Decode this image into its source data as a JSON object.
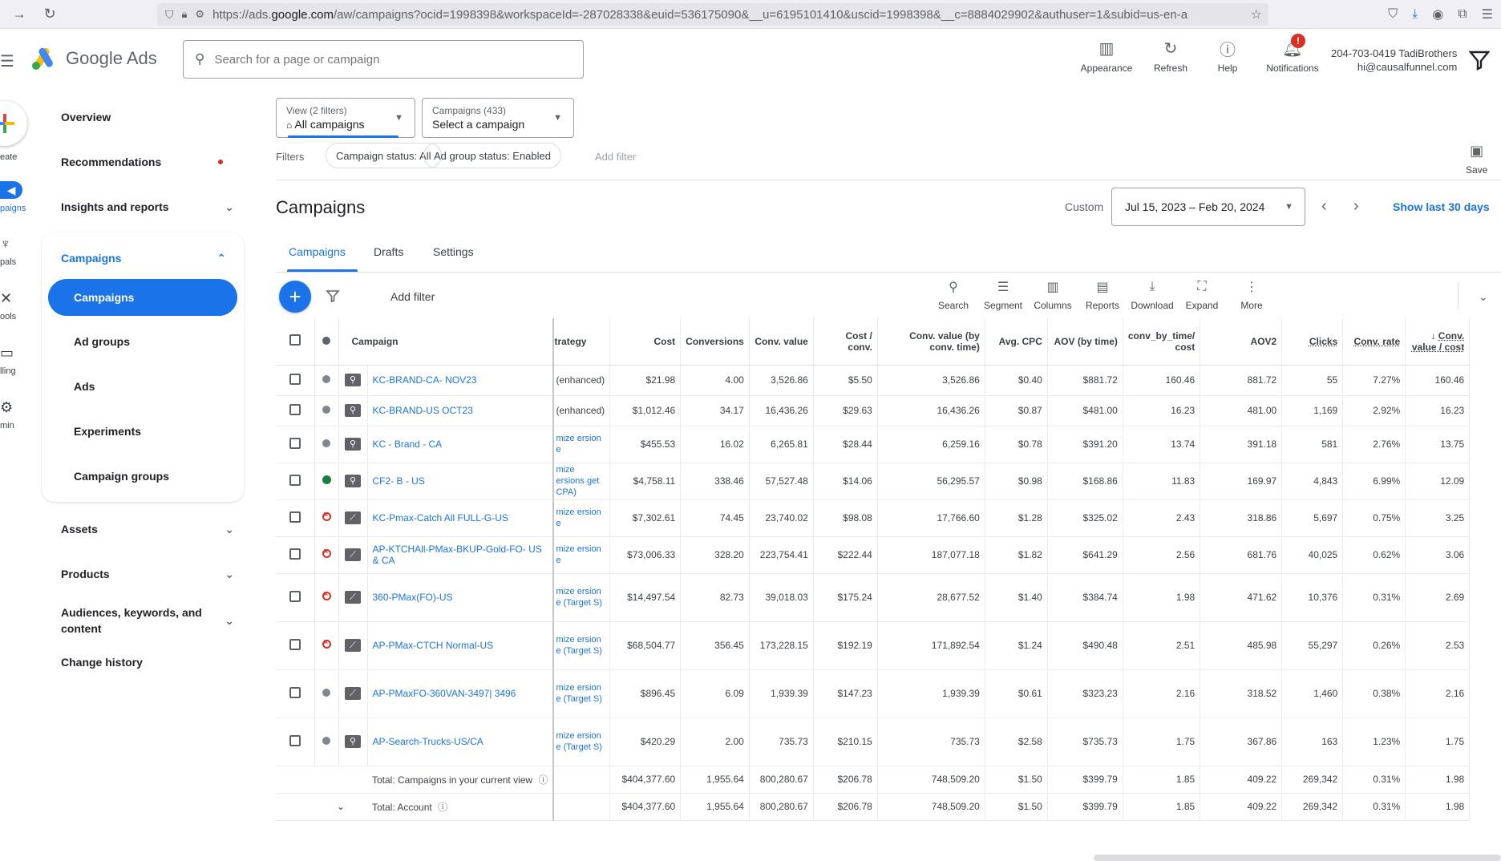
{
  "browser": {
    "url_prefix": "https://ads.",
    "url_domain": "google.com",
    "url_rest": "/aw/campaigns?ocid=1998398&workspaceId=-287028338&euid=536175090&__u=6195101410&uscid=1998398&__c=8884029902&authuser=1&subid=us-en-a"
  },
  "header": {
    "brand": "Google Ads",
    "search_placeholder": "Search for a page or campaign",
    "actions": [
      {
        "label": "Appearance",
        "icon": "appearance-icon"
      },
      {
        "label": "Refresh",
        "icon": "refresh-icon"
      },
      {
        "label": "Help",
        "icon": "help-icon"
      },
      {
        "label": "Notifications",
        "icon": "bell-icon",
        "badge": "!"
      }
    ],
    "account_line1": "204-703-0419 TadiBrothers",
    "account_line2": "hi@causalfunnel.com"
  },
  "rail": {
    "create": "eate",
    "items": [
      "paigns",
      "pals",
      "ools",
      "lling",
      "min"
    ]
  },
  "sidebar": {
    "overview": "Overview",
    "recommendations": "Recommendations",
    "insights": "Insights and reports",
    "campaigns_group": "Campaigns",
    "campaigns_sub": [
      "Campaigns",
      "Ad groups",
      "Ads",
      "Experiments",
      "Campaign groups"
    ],
    "assets": "Assets",
    "products": "Products",
    "audiences": "Audiences, keywords, and content",
    "change_history": "Change history"
  },
  "main": {
    "view_small": "View (2 filters)",
    "view_big": "All campaigns",
    "campaigns_small": "Campaigns (433)",
    "campaigns_big": "Select a campaign",
    "filters_label": "Filters",
    "chip1": "Campaign status: All",
    "chip2": "Ad group status: Enabled",
    "add_filter_top": "Add filter",
    "save": "Save",
    "title": "Campaigns",
    "custom": "Custom",
    "date_range": "Jul 15, 2023 – Feb 20, 2024",
    "show_last": "Show last 30 days",
    "tabs": [
      "Campaigns",
      "Drafts",
      "Settings"
    ],
    "add_filter": "Add filter",
    "toolbar": [
      "Search",
      "Segment",
      "Columns",
      "Reports",
      "Download",
      "Expand",
      "More"
    ]
  },
  "table": {
    "headers": {
      "campaign": "Campaign",
      "strategy": "trategy",
      "cost": "Cost",
      "conversions": "Conversions",
      "conv_value": "Conv. value",
      "cost_conv": "Cost / conv.",
      "conv_value_time": "Conv. value (by conv. time)",
      "avg_cpc": "Avg. CPC",
      "aov_time": "AOV (by time)",
      "conv_by_time_cost": "conv_by_time/ cost",
      "aov2": "AOV2",
      "clicks": "Clicks",
      "conv_rate": "Conv. rate",
      "conv_value_cost": "Conv. value / cost"
    },
    "rows": [
      {
        "status": "paused",
        "type": "search",
        "name": "KC-BRAND-CA- NOV23",
        "strategy": "(enhanced)",
        "strat_gray": true,
        "cost": "$21.98",
        "conv": "4.00",
        "cv": "3,526.86",
        "cpc_conv": "$5.50",
        "cvt": "3,526.86",
        "cpc": "$0.40",
        "aov": "$881.72",
        "cbt": "160.46",
        "aov2": "881.72",
        "clicks": "55",
        "cr": "7.27%",
        "cvc": "160.46"
      },
      {
        "status": "paused",
        "type": "search",
        "name": "KC-BRAND-US OCT23",
        "strategy": "(enhanced)",
        "strat_gray": true,
        "cost": "$1,012.46",
        "conv": "34.17",
        "cv": "16,436.26",
        "cpc_conv": "$29.63",
        "cvt": "16,436.26",
        "cpc": "$0.87",
        "aov": "$481.00",
        "cbt": "16.23",
        "aov2": "481.00",
        "clicks": "1,169",
        "cr": "2.92%",
        "cvc": "16.23"
      },
      {
        "status": "paused",
        "type": "search",
        "name": "KC - Brand - CA",
        "strategy": "mize ersion e",
        "strat_gray": false,
        "cost": "$455.53",
        "conv": "16.02",
        "cv": "6,265.81",
        "cpc_conv": "$28.44",
        "cvt": "6,259.16",
        "cpc": "$0.78",
        "aov": "$391.20",
        "cbt": "13.74",
        "aov2": "391.18",
        "clicks": "581",
        "cr": "2.76%",
        "cvc": "13.75"
      },
      {
        "status": "enabled",
        "type": "search",
        "name": "CF2- B - US",
        "strategy": "mize ersions get CPA)",
        "strat_gray": false,
        "cost": "$4,758.11",
        "conv": "338.46",
        "cv": "57,527.48",
        "cpc_conv": "$14.06",
        "cvt": "56,295.57",
        "cpc": "$0.98",
        "aov": "$168.86",
        "cbt": "11.83",
        "aov2": "169.97",
        "clicks": "4,843",
        "cr": "6.99%",
        "cvc": "12.09"
      },
      {
        "status": "removed",
        "type": "pmax",
        "name": "KC-Pmax-Catch All FULL-G-US",
        "strategy": "mize ersion e",
        "strat_gray": false,
        "cost": "$7,302.61",
        "conv": "74.45",
        "cv": "23,740.02",
        "cpc_conv": "$98.08",
        "cvt": "17,766.60",
        "cpc": "$1.28",
        "aov": "$325.02",
        "cbt": "2.43",
        "aov2": "318.86",
        "clicks": "5,697",
        "cr": "0.75%",
        "cvc": "3.25"
      },
      {
        "status": "removed",
        "type": "pmax",
        "name": "AP-KTCHAll-PMax-BKUP-Gold-FO- US & CA",
        "strategy": "mize ersion e",
        "strat_gray": false,
        "cost": "$73,006.33",
        "conv": "328.20",
        "cv": "223,754.41",
        "cpc_conv": "$222.44",
        "cvt": "187,077.18",
        "cpc": "$1.82",
        "aov": "$641.29",
        "cbt": "2.56",
        "aov2": "681.76",
        "clicks": "40,025",
        "cr": "0.62%",
        "cvc": "3.06"
      },
      {
        "status": "removed",
        "type": "pmax",
        "name": "360-PMax(FO)-US",
        "strategy": "mize ersion e (Target S)",
        "strat_gray": false,
        "cost": "$14,497.54",
        "conv": "82.73",
        "cv": "39,018.03",
        "cpc_conv": "$175.24",
        "cvt": "28,677.52",
        "cpc": "$1.40",
        "aov": "$384.74",
        "cbt": "1.98",
        "aov2": "471.62",
        "clicks": "10,376",
        "cr": "0.31%",
        "cvc": "2.69"
      },
      {
        "status": "removed",
        "type": "pmax",
        "name": "AP-PMax-CTCH Normal-US",
        "strategy": "mize ersion e (Target S)",
        "strat_gray": false,
        "cost": "$68,504.77",
        "conv": "356.45",
        "cv": "173,228.15",
        "cpc_conv": "$192.19",
        "cvt": "171,892.54",
        "cpc": "$1.24",
        "aov": "$490.48",
        "cbt": "2.51",
        "aov2": "485.98",
        "clicks": "55,297",
        "cr": "0.26%",
        "cvc": "2.53"
      },
      {
        "status": "paused",
        "type": "pmax",
        "name": "AP-PMaxFO-360VAN-3497| 3496",
        "strategy": "mize ersion e (Target S)",
        "strat_gray": false,
        "cost": "$896.45",
        "conv": "6.09",
        "cv": "1,939.39",
        "cpc_conv": "$147.23",
        "cvt": "1,939.39",
        "cpc": "$0.61",
        "aov": "$323.23",
        "cbt": "2.16",
        "aov2": "318.52",
        "clicks": "1,460",
        "cr": "0.38%",
        "cvc": "2.16"
      },
      {
        "status": "paused",
        "type": "search",
        "name": "AP-Search-Trucks-US/CA",
        "strategy": "mize ersion e (Target S)",
        "strat_gray": false,
        "cost": "$420.29",
        "conv": "2.00",
        "cv": "735.73",
        "cpc_conv": "$210.15",
        "cvt": "735.73",
        "cpc": "$2.58",
        "aov": "$735.73",
        "cbt": "1.75",
        "aov2": "367.86",
        "clicks": "163",
        "cr": "1.23%",
        "cvc": "1.75"
      }
    ],
    "totals": [
      {
        "label": "Total: Campaigns in your current view",
        "cost": "$404,377.60",
        "conv": "1,955.64",
        "cv": "800,280.67",
        "cpc_conv": "$206.78",
        "cvt": "748,509.20",
        "cpc": "$1.50",
        "aov": "$399.79",
        "cbt": "1.85",
        "aov2": "409.22",
        "clicks": "269,342",
        "cr": "0.31%",
        "cvc": "1.98"
      },
      {
        "label": "Total: Account",
        "cost": "$404,377.60",
        "conv": "1,955.64",
        "cv": "800,280.67",
        "cpc_conv": "$206.78",
        "cvt": "748,509.20",
        "cpc": "$1.50",
        "aov": "$399.79",
        "cbt": "1.85",
        "aov2": "409.22",
        "clicks": "269,342",
        "cr": "0.31%",
        "cvc": "1.98"
      }
    ]
  },
  "colors": {
    "accent": "#1a73e8",
    "removed": "#d93025",
    "enabled": "#188038",
    "paused": "#80868b"
  }
}
